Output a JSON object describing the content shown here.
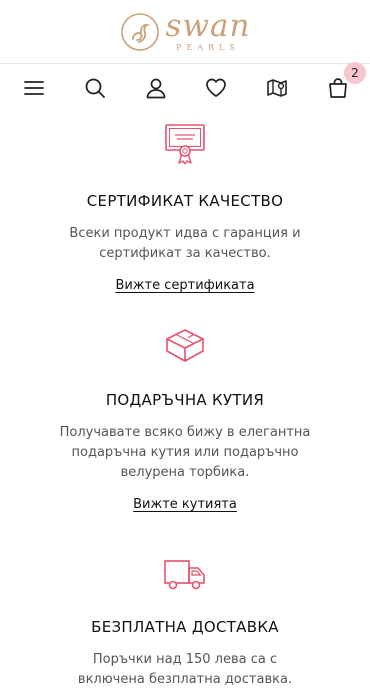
{
  "brand": {
    "name": "swan",
    "tagline": "PEARLS"
  },
  "nav": {
    "cart_count": "2"
  },
  "features": [
    {
      "title": "СЕРТИФИКАТ КАЧЕСТВО",
      "desc_lines": [
        "Всеки продукт идва с гаранция и",
        "сертификат за качество."
      ],
      "link": "Вижте сертификата",
      "icon": "certificate-icon"
    },
    {
      "title": "ПОДАРЪЧНА КУТИЯ",
      "desc_lines": [
        "Получавате всяко бижу в елегантна",
        "подаръчна кутия или подаръчно",
        "велурена торбика."
      ],
      "link": "Вижте кутията",
      "icon": "gift-box-icon"
    },
    {
      "title": "БЕЗПЛАТНА ДОСТАВКА",
      "desc_lines": [
        "Поръчки над 150 лева са с",
        "включена безплатна доставка."
      ],
      "link": "",
      "icon": "delivery-truck-icon"
    }
  ],
  "colors": {
    "accent_pink": "#e8516d",
    "gold": "#c9a27c",
    "badge_bg": "#f7c6cf"
  }
}
